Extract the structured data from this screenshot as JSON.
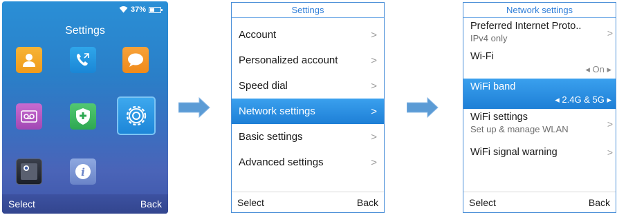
{
  "home": {
    "status": {
      "battery": "37%",
      "wifi_icon": "wifi-icon",
      "battery_icon": "battery-icon"
    },
    "title": "Settings",
    "apps": [
      {
        "name": "contacts",
        "icon": "contacts-icon"
      },
      {
        "name": "call-history",
        "icon": "call-history-icon"
      },
      {
        "name": "messages",
        "icon": "message-icon"
      },
      {
        "name": "voicemail",
        "icon": "voicemail-icon"
      },
      {
        "name": "security",
        "icon": "shield-icon"
      },
      {
        "name": "settings",
        "icon": "gear-icon",
        "selected": true
      },
      {
        "name": "camera",
        "icon": "camera-icon"
      },
      {
        "name": "info",
        "icon": "info-icon"
      }
    ],
    "softkeys": {
      "left": "Select",
      "right": "Back"
    }
  },
  "settings_menu": {
    "title": "Settings",
    "items": [
      {
        "label": "Account",
        "chevron": ">"
      },
      {
        "label": "Personalized account",
        "chevron": ">"
      },
      {
        "label": "Speed dial",
        "chevron": ">"
      },
      {
        "label": "Network settings",
        "chevron": ">",
        "selected": true
      },
      {
        "label": "Basic settings",
        "chevron": ">"
      },
      {
        "label": "Advanced settings",
        "chevron": ">"
      }
    ],
    "softkeys": {
      "left": "Select",
      "right": "Back"
    }
  },
  "network_settings": {
    "title": "Network settings",
    "items": [
      {
        "label": "Preferred Internet Proto..",
        "sub": "IPv4 only",
        "chevron": ">"
      },
      {
        "label": "Wi-Fi",
        "value": "◂ On ▸"
      },
      {
        "label": "WiFi band",
        "value": "◂ 2.4G & 5G ▸",
        "selected": true
      },
      {
        "label": "WiFi settings",
        "sub": "Set up & manage WLAN",
        "chevron": ">"
      },
      {
        "label": "WiFi signal warning",
        "chevron": ">"
      }
    ],
    "softkeys": {
      "left": "Select",
      "right": "Back"
    }
  },
  "colors": {
    "accent": "#1e7fd6",
    "header_text": "#2f7ed8",
    "arrow": "#5b9bd5"
  }
}
